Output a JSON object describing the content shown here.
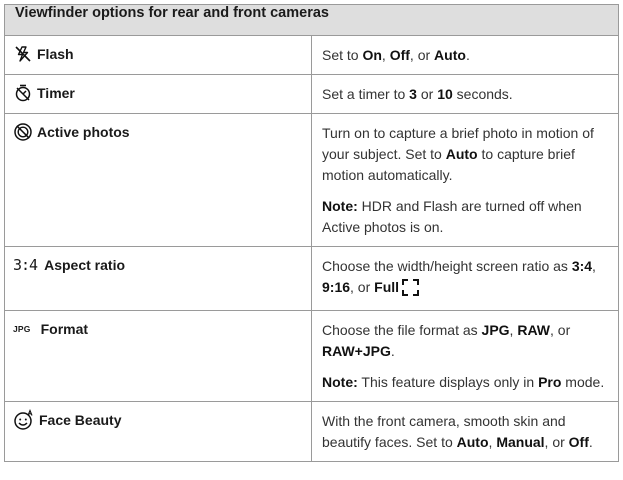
{
  "table": {
    "title": "Viewfinder options for rear and front cameras",
    "rows": [
      {
        "icon": "flash-off-icon",
        "label": "Flash",
        "desc": {
          "t0": "Set to ",
          "on": "On",
          "t1": ", ",
          "off": "Off",
          "t2": ", or ",
          "auto": "Auto",
          "t3": "."
        }
      },
      {
        "icon": "timer-icon",
        "label": "Timer",
        "desc": {
          "t0": "Set a timer to ",
          "three": "3",
          "t1": " or ",
          "ten": "10",
          "t2": " seconds."
        }
      },
      {
        "icon": "active-photos-icon",
        "label": "Active photos",
        "desc": {
          "t0": "Turn on to capture a brief photo in motion of your subject. Set to ",
          "auto": "Auto",
          "t1": " to capture brief motion automatically.",
          "note_label": "Note:",
          "note_text": " HDR and Flash are turned off when Active photos is on."
        }
      },
      {
        "icon_text": "3:4",
        "label": "Aspect ratio",
        "desc": {
          "t0": "Choose the width/height screen ratio as ",
          "r34": "3:4",
          "t1": ", ",
          "r916": "9:16",
          "t2": ", or ",
          "full": "Full"
        }
      },
      {
        "icon_text": "JPG",
        "label": "Format",
        "desc": {
          "t0": "Choose the file format as ",
          "jpg": "JPG",
          "t1": ", ",
          "raw": "RAW",
          "t2": ", or ",
          "rawjpg": "RAW+JPG",
          "t3": ".",
          "note_label": "Note:",
          "note_text": " This feature displays only in ",
          "pro": "Pro",
          "note_end": " mode."
        }
      },
      {
        "icon": "face-beauty-icon",
        "label": "Face Beauty",
        "desc": {
          "t0": "With the front camera, smooth skin and beautify faces. Set to ",
          "auto": "Auto",
          "t1": ", ",
          "manual": "Manual",
          "t2": ", or ",
          "off": "Off",
          "t3": "."
        }
      }
    ]
  }
}
